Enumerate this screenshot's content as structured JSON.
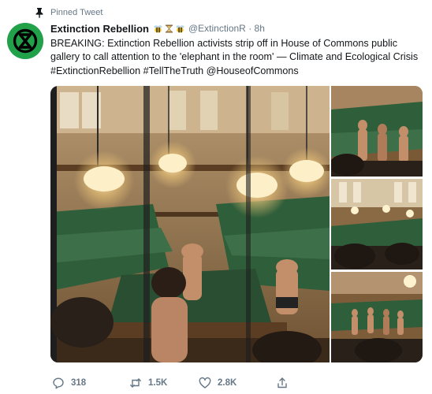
{
  "pinned_label": "Pinned Tweet",
  "author": {
    "display_name": "Extinction Rebellion",
    "emoji": [
      "bee-emoji",
      "hourglass-emoji",
      "bee-emoji"
    ],
    "handle": "@ExtinctionR",
    "separator": "·",
    "time": "8h",
    "avatar_color": "#21a24a"
  },
  "tweet_text": "BREAKING: Extinction Rebellion activists strip off in House of Commons public gallery to call attention to the 'elephant in the room' — Climate and Ecological Crisis #ExtinctionRebellion #TellTheTruth @HouseofCommons",
  "media": {
    "photo_count": 4
  },
  "actions": {
    "reply_count": "318",
    "retweet_count": "1.5K",
    "like_count": "2.8K"
  },
  "colors": {
    "text": "#14171a",
    "muted": "#657786",
    "bench_green": "#2f5e3a",
    "wood": "#7a5a36"
  }
}
